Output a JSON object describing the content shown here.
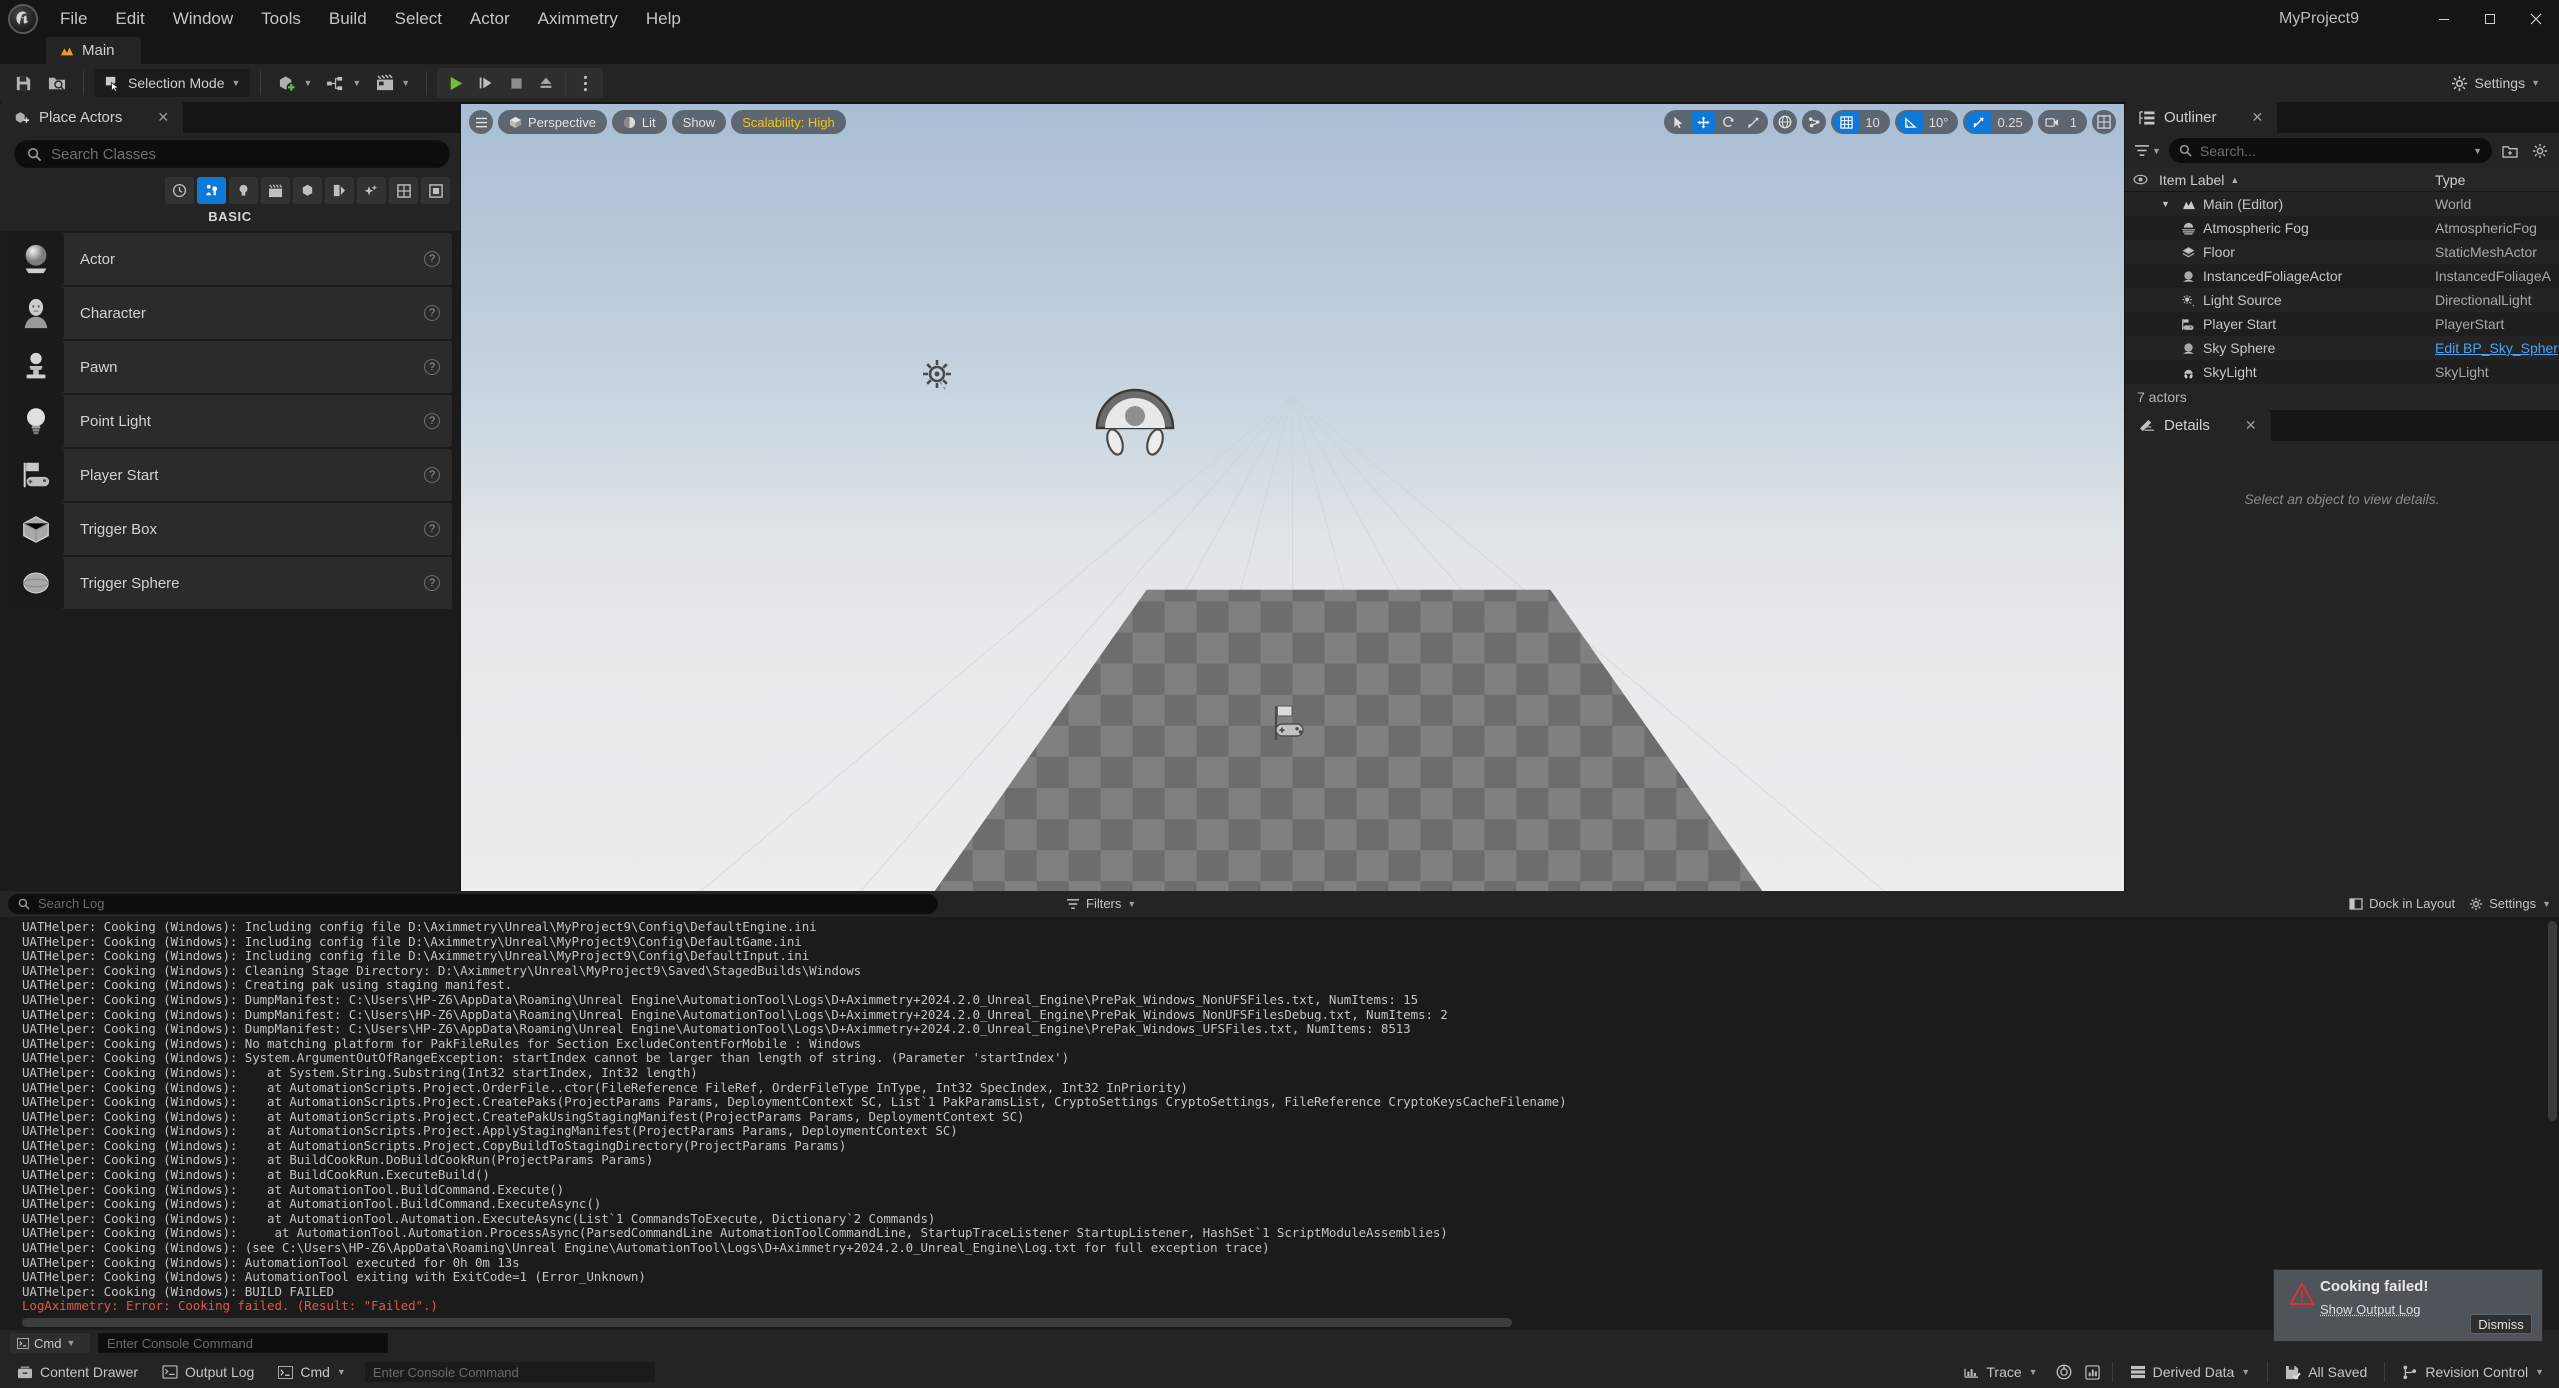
{
  "window": {
    "project_name": "MyProject9",
    "minimize": "–",
    "maximize": "▢",
    "close": "✕"
  },
  "menubar": {
    "items": [
      "File",
      "Edit",
      "Window",
      "Tools",
      "Build",
      "Select",
      "Actor",
      "Aximmetry",
      "Help"
    ]
  },
  "level_tab": {
    "label": "Main"
  },
  "toolbar": {
    "save_label": "",
    "selection_mode": "Selection Mode",
    "settings_label": "Settings"
  },
  "place_actors": {
    "tab_title": "Place Actors",
    "close": "✕",
    "search_placeholder": "Search Classes",
    "categories": [
      {
        "name": "recently-placed-icon",
        "glyph": "◴",
        "active": false
      },
      {
        "name": "basic-icon",
        "glyph": "♟",
        "active": true
      },
      {
        "name": "lights-icon",
        "glyph": "●",
        "active": false
      },
      {
        "name": "cinematic-icon",
        "glyph": "▭",
        "active": false
      },
      {
        "name": "visual-effects-icon",
        "glyph": "⬟",
        "active": false
      },
      {
        "name": "geometry-icon",
        "glyph": "◗",
        "active": false
      },
      {
        "name": "volumes-icon",
        "glyph": "✨",
        "active": false
      },
      {
        "name": "all-classes-icon",
        "glyph": "▦",
        "active": false
      },
      {
        "name": "more-icon",
        "glyph": "▣",
        "active": false
      }
    ],
    "section_label": "BASIC",
    "items": [
      {
        "label": "Actor",
        "icon": "actor-sphere-icon",
        "help": "?"
      },
      {
        "label": "Character",
        "icon": "character-bust-icon",
        "help": "?"
      },
      {
        "label": "Pawn",
        "icon": "pawn-icon",
        "help": "?"
      },
      {
        "label": "Point Light",
        "icon": "point-light-icon",
        "help": "?"
      },
      {
        "label": "Player Start",
        "icon": "player-start-icon",
        "help": "?"
      },
      {
        "label": "Trigger Box",
        "icon": "trigger-box-icon",
        "help": "?"
      },
      {
        "label": "Trigger Sphere",
        "icon": "trigger-sphere-icon",
        "help": "?"
      }
    ]
  },
  "viewport": {
    "menu_icon": "hamburger-icon",
    "perspective": "Perspective",
    "lit": "Lit",
    "show": "Show",
    "scalability": "Scalability: High",
    "scalability_color": "#f1c40f",
    "grid_snap_value": "10",
    "angle_snap_value": "10°",
    "scale_snap_value": "0.25",
    "camera_speed_value": "1",
    "active_transform": "move"
  },
  "outliner": {
    "tab_title": "Outliner",
    "close": "✕",
    "search_placeholder": "Search...",
    "col_item_label": "Item Label",
    "col_type": "Type",
    "sort_arrow": "▲",
    "rows": [
      {
        "label": "Main (Editor)",
        "type": "World",
        "depth": 0,
        "expanded": true,
        "icon": "level-icon",
        "link": false
      },
      {
        "label": "Atmospheric Fog",
        "type": "AtmosphericFog",
        "depth": 1,
        "icon": "fog-icon",
        "link": false
      },
      {
        "label": "Floor",
        "type": "StaticMeshActor",
        "depth": 1,
        "icon": "static-mesh-icon",
        "link": false
      },
      {
        "label": "InstancedFoliageActor",
        "type": "InstancedFoliageA",
        "depth": 1,
        "icon": "foliage-icon",
        "link": false
      },
      {
        "label": "Light Source",
        "type": "DirectionalLight",
        "depth": 1,
        "icon": "directional-light-icon",
        "link": false
      },
      {
        "label": "Player Start",
        "type": "PlayerStart",
        "depth": 1,
        "icon": "player-start-icon",
        "link": false
      },
      {
        "label": "Sky Sphere",
        "type": "Edit BP_Sky_Spher",
        "depth": 1,
        "icon": "sky-sphere-icon",
        "link": true
      },
      {
        "label": "SkyLight",
        "type": "SkyLight",
        "depth": 1,
        "icon": "sky-light-icon",
        "link": false
      }
    ],
    "actor_count": "7 actors"
  },
  "details": {
    "tab_title": "Details",
    "close": "✕",
    "empty_message": "Select an object to view details."
  },
  "output_log": {
    "search_placeholder": "Search Log",
    "filters_label": "Filters",
    "dock_in_layout": "Dock in Layout",
    "settings_label": "Settings",
    "cmd_label": "Cmd",
    "console_placeholder": "Enter Console Command",
    "lines": [
      {
        "text": "UATHelper: Cooking (Windows): Including config file D:\\Aximmetry\\Unreal\\MyProject9\\Config\\DefaultEngine.ini",
        "error": false
      },
      {
        "text": "UATHelper: Cooking (Windows): Including config file D:\\Aximmetry\\Unreal\\MyProject9\\Config\\DefaultGame.ini",
        "error": false
      },
      {
        "text": "UATHelper: Cooking (Windows): Including config file D:\\Aximmetry\\Unreal\\MyProject9\\Config\\DefaultInput.ini",
        "error": false
      },
      {
        "text": "UATHelper: Cooking (Windows): Cleaning Stage Directory: D:\\Aximmetry\\Unreal\\MyProject9\\Saved\\StagedBuilds\\Windows",
        "error": false
      },
      {
        "text": "UATHelper: Cooking (Windows): Creating pak using staging manifest.",
        "error": false
      },
      {
        "text": "UATHelper: Cooking (Windows): DumpManifest: C:\\Users\\HP-Z6\\AppData\\Roaming\\Unreal Engine\\AutomationTool\\Logs\\D+Aximmetry+2024.2.0_Unreal_Engine\\PrePak_Windows_NonUFSFiles.txt, NumItems: 15",
        "error": false
      },
      {
        "text": "UATHelper: Cooking (Windows): DumpManifest: C:\\Users\\HP-Z6\\AppData\\Roaming\\Unreal Engine\\AutomationTool\\Logs\\D+Aximmetry+2024.2.0_Unreal_Engine\\PrePak_Windows_NonUFSFilesDebug.txt, NumItems: 2",
        "error": false
      },
      {
        "text": "UATHelper: Cooking (Windows): DumpManifest: C:\\Users\\HP-Z6\\AppData\\Roaming\\Unreal Engine\\AutomationTool\\Logs\\D+Aximmetry+2024.2.0_Unreal_Engine\\PrePak_Windows_UFSFiles.txt, NumItems: 8513",
        "error": false
      },
      {
        "text": "UATHelper: Cooking (Windows): No matching platform for PakFileRules for Section ExcludeContentForMobile : Windows",
        "error": false
      },
      {
        "text": "UATHelper: Cooking (Windows): System.ArgumentOutOfRangeException: startIndex cannot be larger than length of string. (Parameter 'startIndex')",
        "error": false
      },
      {
        "text": "UATHelper: Cooking (Windows):    at System.String.Substring(Int32 startIndex, Int32 length)",
        "error": false
      },
      {
        "text": "UATHelper: Cooking (Windows):    at AutomationScripts.Project.OrderFile..ctor(FileReference FileRef, OrderFileType InType, Int32 SpecIndex, Int32 InPriority)",
        "error": false
      },
      {
        "text": "UATHelper: Cooking (Windows):    at AutomationScripts.Project.CreatePaks(ProjectParams Params, DeploymentContext SC, List`1 PakParamsList, CryptoSettings CryptoSettings, FileReference CryptoKeysCacheFilename)",
        "error": false
      },
      {
        "text": "UATHelper: Cooking (Windows):    at AutomationScripts.Project.CreatePakUsingStagingManifest(ProjectParams Params, DeploymentContext SC)",
        "error": false
      },
      {
        "text": "UATHelper: Cooking (Windows):    at AutomationScripts.Project.ApplyStagingManifest(ProjectParams Params, DeploymentContext SC)",
        "error": false
      },
      {
        "text": "UATHelper: Cooking (Windows):    at AutomationScripts.Project.CopyBuildToStagingDirectory(ProjectParams Params)",
        "error": false
      },
      {
        "text": "UATHelper: Cooking (Windows):    at BuildCookRun.DoBuildCookRun(ProjectParams Params)",
        "error": false
      },
      {
        "text": "UATHelper: Cooking (Windows):    at BuildCookRun.ExecuteBuild()",
        "error": false
      },
      {
        "text": "UATHelper: Cooking (Windows):    at AutomationTool.BuildCommand.Execute()",
        "error": false
      },
      {
        "text": "UATHelper: Cooking (Windows):    at AutomationTool.BuildCommand.ExecuteAsync()",
        "error": false
      },
      {
        "text": "UATHelper: Cooking (Windows):    at AutomationTool.Automation.ExecuteAsync(List`1 CommandsToExecute, Dictionary`2 Commands)",
        "error": false
      },
      {
        "text": "UATHelper: Cooking (Windows):     at AutomationTool.Automation.ProcessAsync(ParsedCommandLine AutomationToolCommandLine, StartupTraceListener StartupListener, HashSet`1 ScriptModuleAssemblies)",
        "error": false
      },
      {
        "text": "UATHelper: Cooking (Windows): (see C:\\Users\\HP-Z6\\AppData\\Roaming\\Unreal Engine\\AutomationTool\\Logs\\D+Aximmetry+2024.2.0_Unreal_Engine\\Log.txt for full exception trace)",
        "error": false
      },
      {
        "text": "UATHelper: Cooking (Windows): AutomationTool executed for 0h 0m 13s",
        "error": false
      },
      {
        "text": "UATHelper: Cooking (Windows): AutomationTool exiting with ExitCode=1 (Error_Unknown)",
        "error": false
      },
      {
        "text": "UATHelper: Cooking (Windows): BUILD FAILED",
        "error": false
      },
      {
        "text": "LogAximmetry: Error: Cooking failed. (Result: \"Failed\".)",
        "error": true
      }
    ]
  },
  "toast": {
    "title": "Cooking failed!",
    "link": "Show Output Log",
    "dismiss": "Dismiss",
    "icon_color": "#e03030"
  },
  "statusbar": {
    "content_drawer": "Content Drawer",
    "output_log": "Output Log",
    "cmd": "Cmd",
    "console_placeholder": "Enter Console Command",
    "trace": "Trace",
    "derived_data": "Derived Data",
    "all_saved": "All Saved",
    "revision_control": "Revision Control"
  }
}
